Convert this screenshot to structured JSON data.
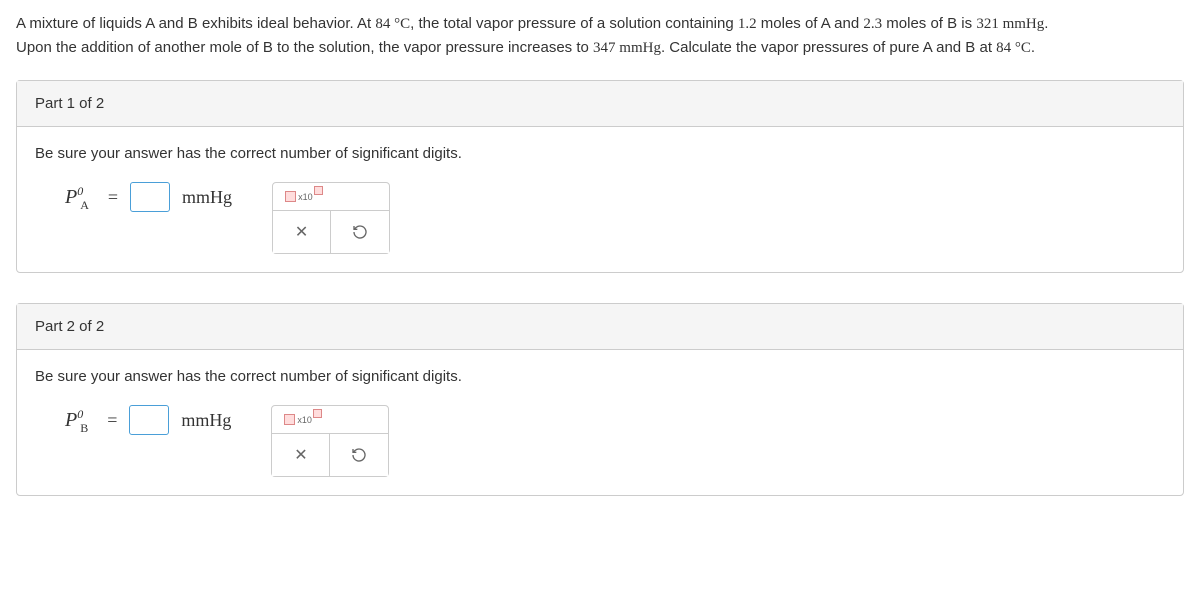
{
  "problem": {
    "line1_a": "A mixture of liquids A and B exhibits ideal behavior. At ",
    "temp1": "84 °C",
    "line1_b": ", the total vapor pressure of a solution containing ",
    "moles_a": "1.2",
    "line1_c": " moles of A and ",
    "moles_b": "2.3",
    "line1_d": " moles of B is ",
    "pressure1": "321 mmHg",
    "line1_e": ".",
    "line2_a": "Upon the addition of another mole of B to the solution, the vapor pressure increases to ",
    "pressure2": "347 mmHg",
    "line2_b": ". Calculate the vapor pressures of pure A and B at ",
    "temp2": "84 °C",
    "line2_c": "."
  },
  "part1": {
    "header": "Part 1 of 2",
    "instruction": "Be sure your answer has the correct number of significant digits.",
    "var_base": "P",
    "var_super": "0",
    "var_sub": "A",
    "equals": "=",
    "unit": "mmHg",
    "sci_label": "x10"
  },
  "part2": {
    "header": "Part 2 of 2",
    "instruction": "Be sure your answer has the correct number of significant digits.",
    "var_base": "P",
    "var_super": "0",
    "var_sub": "B",
    "equals": "=",
    "unit": "mmHg",
    "sci_label": "x10"
  }
}
